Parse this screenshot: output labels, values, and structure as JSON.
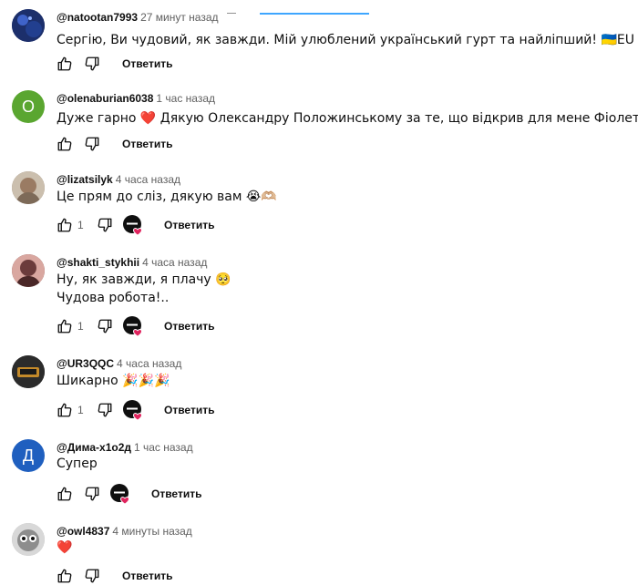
{
  "comments": [
    {
      "author": "@natootan7993",
      "time": "27 минут назад",
      "lines": [
        "Сергію, Ви чудовий, як завжди. Мій улюблений український гурт та найліпший! 🇺🇦EU"
      ],
      "likes": "",
      "hearted": false,
      "reply": "Ответить",
      "avatar": {
        "type": "image",
        "color": "#1c2f6b",
        "letter": ""
      }
    },
    {
      "author": "@olenaburian6038",
      "time": "1 час назад",
      "lines": [
        "Дуже гарно ❤️  Дякую Олександру Положинському за те, що відкрив для мене Фіолет!"
      ],
      "likes": "",
      "hearted": false,
      "reply": "Ответить",
      "avatar": {
        "type": "letter",
        "color": "#5aa630",
        "letter": "O"
      }
    },
    {
      "author": "@lizatsilyk",
      "time": "4 часа назад",
      "lines": [
        "Це прям до сліз, дякую вам 😭🫶🏼"
      ],
      "likes": "1",
      "hearted": true,
      "reply": "Ответить",
      "avatar": {
        "type": "image",
        "color": "#8a7a6a",
        "letter": ""
      }
    },
    {
      "author": "@shakti_stykhii",
      "time": "4 часа назад",
      "lines": [
        "Ну, як завжди, я плачу 🥺",
        "Чудова робота!.."
      ],
      "likes": "1",
      "hearted": true,
      "reply": "Ответить",
      "avatar": {
        "type": "image",
        "color": "#6b3b3b",
        "letter": ""
      }
    },
    {
      "author": "@UR3QQC",
      "time": "4 часа назад",
      "lines": [
        "Шикарно 🎉🎉🎉"
      ],
      "likes": "1",
      "hearted": true,
      "reply": "Ответить",
      "avatar": {
        "type": "image",
        "color": "#2b2b2b",
        "letter": ""
      }
    },
    {
      "author": "@Дима-х1о2д",
      "time": "1 час назад",
      "lines": [
        "Супер"
      ],
      "likes": "",
      "hearted": true,
      "reply": "Ответить",
      "avatar": {
        "type": "letter",
        "color": "#1f5fbf",
        "letter": "Д"
      }
    },
    {
      "author": "@owl4837",
      "time": "4 минуты назад",
      "lines": [
        "❤️"
      ],
      "likes": "",
      "hearted": false,
      "reply": "Ответить",
      "avatar": {
        "type": "image",
        "color": "#b5b5b5",
        "letter": ""
      }
    }
  ],
  "colors": {
    "heart": "#e0245e",
    "creator_badge": "#0f0f0f",
    "link_accent": "#3ea6ff"
  }
}
